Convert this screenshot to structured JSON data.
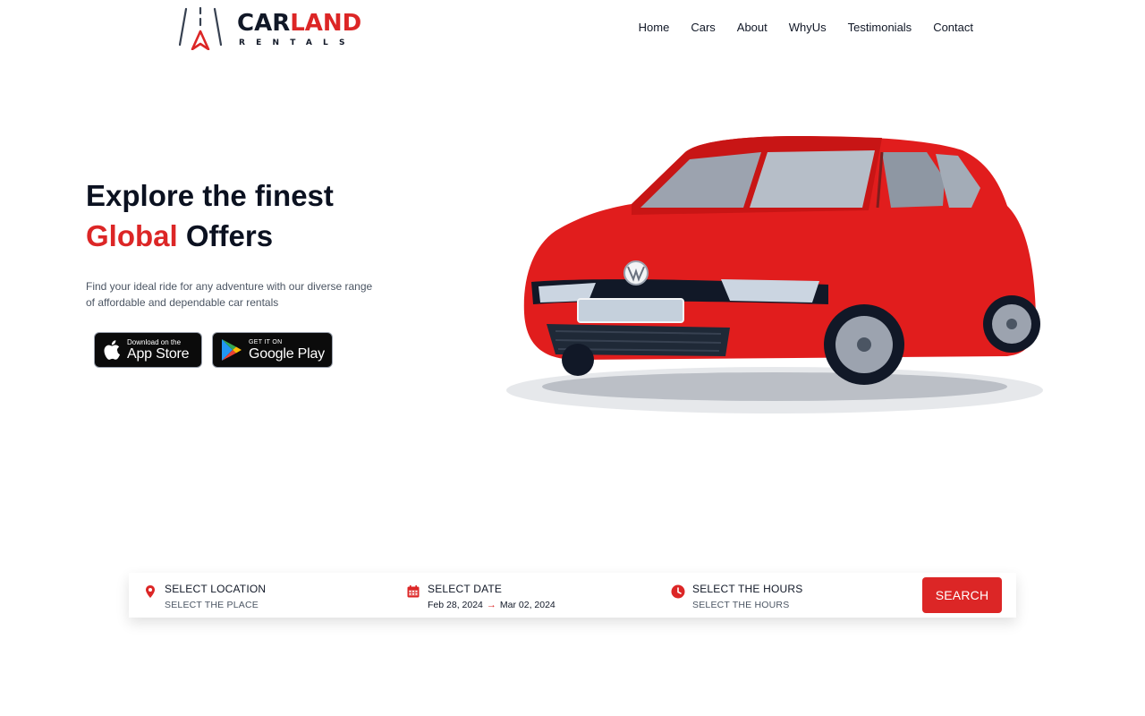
{
  "brand": {
    "word_part1": "CAR",
    "word_part2": "LAND",
    "sub": "RENTALS"
  },
  "nav": [
    "Home",
    "Cars",
    "About",
    "WhyUs",
    "Testimonials",
    "Contact"
  ],
  "hero": {
    "title_line1": "Explore the finest",
    "title_accent": "Global",
    "title_rest": "Offers",
    "description": "Find your ideal ride for any adventure with our diverse range of affordable and dependable car rentals"
  },
  "app_store": {
    "small": "Download on the",
    "big": "App Store"
  },
  "google_play": {
    "small": "GET IT ON",
    "big": "Google Play"
  },
  "search": {
    "location_label": "SELECT LOCATION",
    "location_sub": "SELECT THE PLACE",
    "date_label": "SELECT DATE",
    "date_start": "Feb 28, 2024",
    "date_end": "Mar 02, 2024",
    "hours_label": "SELECT THE HOURS",
    "hours_sub": "SELECT THE HOURS",
    "button": "SEARCH"
  },
  "colors": {
    "accent": "#dc2626",
    "dark": "#111827",
    "car_body": "#e11d1d"
  },
  "icons": [
    "map-pin-icon",
    "calendar-icon",
    "clock-icon",
    "apple-icon",
    "google-play-icon"
  ]
}
